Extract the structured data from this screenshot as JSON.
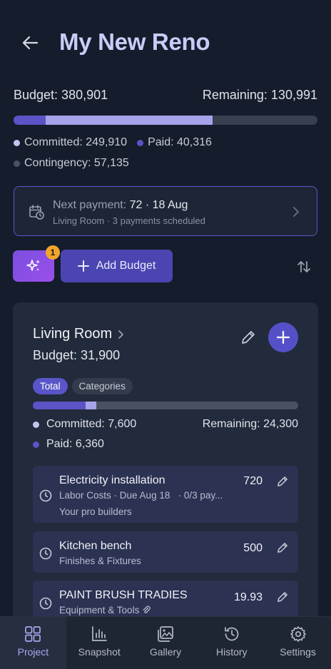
{
  "header": {
    "title": "My New Reno"
  },
  "summary": {
    "budget_label": "Budget: 380,901",
    "remaining_label": "Remaining: 130,991",
    "paid_fraction": 0.106,
    "committed_fraction": 0.656,
    "committed_label": "Committed: 249,910",
    "paid_label": "Paid: 40,316",
    "contingency_label": "Contingency: 57,135"
  },
  "colors": {
    "committed": "#a7a3ea",
    "paid": "#5b53c6",
    "contingency": "#4a5266",
    "accent": "#5550c8"
  },
  "next_payment": {
    "label": "Next payment:",
    "value": "72 · 18 Aug",
    "detail": "Living Room · 3 payments scheduled"
  },
  "actions": {
    "ai_badge_count": "1",
    "add_budget_label": "Add Budget"
  },
  "room": {
    "title": "Living Room",
    "budget_label": "Budget: 31,900",
    "tabs": {
      "total": "Total",
      "categories": "Categories"
    },
    "paid_fraction": 0.2,
    "committed_fraction": 0.238,
    "committed_label": "Committed: 7,600",
    "remaining_label": "Remaining: 24,300",
    "paid_label": "Paid: 6,360",
    "items": [
      {
        "name": "Electricity installation",
        "sub1": "Labor Costs · Due Aug 18",
        "sub1b": "· 0/3 pay...",
        "sub2": "Your pro builders",
        "amount": "720"
      },
      {
        "name": "Kitchen bench",
        "sub1": "Finishes & Fixtures",
        "amount": "500"
      },
      {
        "name": "PAINT BRUSH TRADIES",
        "sub1": "Equipment & Tools",
        "amount": "19.93"
      }
    ]
  },
  "nav": [
    {
      "label": "Project",
      "icon": "grid-icon",
      "active": true
    },
    {
      "label": "Snapshot",
      "icon": "bar-chart-icon"
    },
    {
      "label": "Gallery",
      "icon": "gallery-icon"
    },
    {
      "label": "History",
      "icon": "history-icon"
    },
    {
      "label": "Settings",
      "icon": "gear-icon"
    }
  ]
}
